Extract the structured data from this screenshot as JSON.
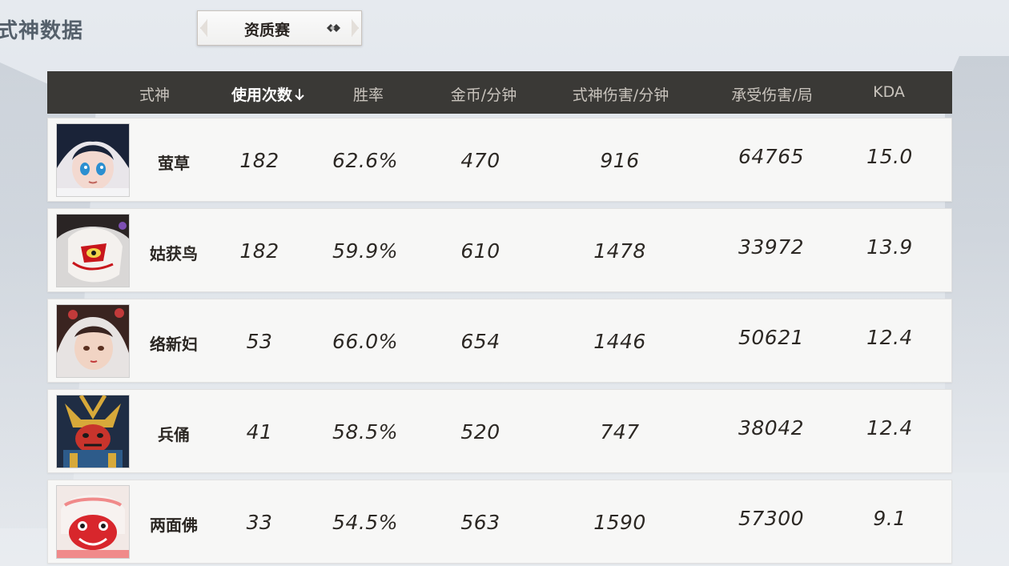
{
  "page_title": "式神数据",
  "mode_select": {
    "label": "资质赛",
    "icon": "diamond-switch-icon"
  },
  "table": {
    "headers": [
      "式神",
      "使用次数",
      "胜率",
      "金币/分钟",
      "式神伤害/分钟",
      "承受伤害/局",
      "KDA"
    ],
    "sort": {
      "column": "使用次数",
      "direction": "descending",
      "icon": "arrow-down-icon"
    },
    "rows": [
      {
        "name": "萤草",
        "uses": "182",
        "win_rate": "62.6%",
        "gold_per_min": "470",
        "damage_per_min": "916",
        "damage_taken": "64765",
        "kda": "15.0",
        "avatar_colors": [
          "#1a2338",
          "#f3d9d0",
          "#2c8fd0"
        ]
      },
      {
        "name": "姑获鸟",
        "uses": "182",
        "win_rate": "59.9%",
        "gold_per_min": "610",
        "damage_per_min": "1478",
        "damage_taken": "33972",
        "kda": "13.9",
        "avatar_colors": [
          "#2a2424",
          "#f4f1ee",
          "#c8161c"
        ]
      },
      {
        "name": "络新妇",
        "uses": "53",
        "win_rate": "66.0%",
        "gold_per_min": "654",
        "damage_per_min": "1446",
        "damage_taken": "50621",
        "kda": "12.4",
        "avatar_colors": [
          "#3a2420",
          "#f1d4c4",
          "#c23a3a"
        ]
      },
      {
        "name": "兵俑",
        "uses": "41",
        "win_rate": "58.5%",
        "gold_per_min": "520",
        "damage_per_min": "747",
        "damage_taken": "38042",
        "kda": "12.4",
        "avatar_colors": [
          "#1f2d44",
          "#c8342c",
          "#d7a93a"
        ]
      },
      {
        "name": "两面佛",
        "uses": "33",
        "win_rate": "54.5%",
        "gold_per_min": "563",
        "damage_per_min": "1590",
        "damage_taken": "57300",
        "kda": "9.1",
        "avatar_colors": [
          "#f2e9e6",
          "#d8262c",
          "#f08a8a"
        ]
      }
    ]
  },
  "colors": {
    "header_bg": "#3a3936",
    "header_text": "#c9c4bd",
    "row_bg": "#f7f7f6",
    "accent_active": "#ffffff"
  }
}
